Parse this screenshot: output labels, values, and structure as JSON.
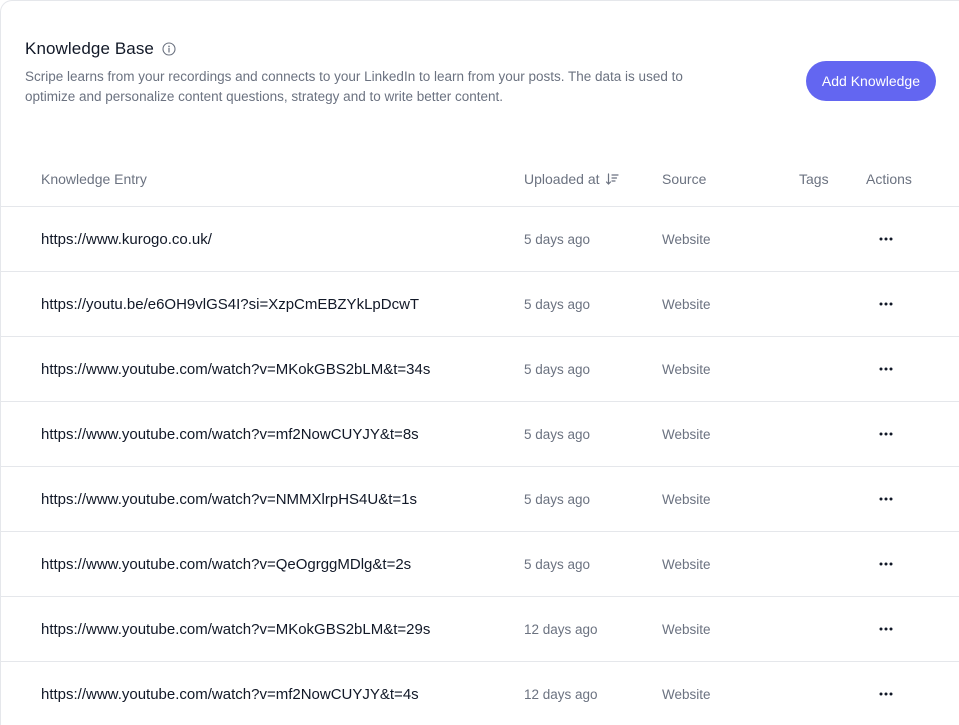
{
  "header": {
    "title": "Knowledge Base",
    "description": "Scripe learns from your recordings and connects to your LinkedIn to learn from your posts. The data is used to optimize and personalize content questions, strategy and to write better content.",
    "add_button_label": "Add Knowledge",
    "info_icon": "info-circle-icon"
  },
  "colors": {
    "accent": "#6366f1",
    "text_primary": "#111827",
    "text_muted": "#6b7280",
    "border": "#e5e7eb"
  },
  "table": {
    "columns": {
      "entry": "Knowledge Entry",
      "uploaded": "Uploaded at",
      "source": "Source",
      "tags": "Tags",
      "actions": "Actions"
    },
    "sort_icon": "sort-descending-icon",
    "actions_icon": "more-horizontal-icon",
    "rows": [
      {
        "entry": "https://www.kurogo.co.uk/",
        "uploaded": "5 days ago",
        "source": "Website",
        "tags": ""
      },
      {
        "entry": "https://youtu.be/e6OH9vlGS4I?si=XzpCmEBZYkLpDcwT",
        "uploaded": "5 days ago",
        "source": "Website",
        "tags": ""
      },
      {
        "entry": "https://www.youtube.com/watch?v=MKokGBS2bLM&t=34s",
        "uploaded": "5 days ago",
        "source": "Website",
        "tags": ""
      },
      {
        "entry": "https://www.youtube.com/watch?v=mf2NowCUYJY&t=8s",
        "uploaded": "5 days ago",
        "source": "Website",
        "tags": ""
      },
      {
        "entry": "https://www.youtube.com/watch?v=NMMXlrpHS4U&t=1s",
        "uploaded": "5 days ago",
        "source": "Website",
        "tags": ""
      },
      {
        "entry": "https://www.youtube.com/watch?v=QeOgrggMDlg&t=2s",
        "uploaded": "5 days ago",
        "source": "Website",
        "tags": ""
      },
      {
        "entry": "https://www.youtube.com/watch?v=MKokGBS2bLM&t=29s",
        "uploaded": "12 days ago",
        "source": "Website",
        "tags": ""
      },
      {
        "entry": "https://www.youtube.com/watch?v=mf2NowCUYJY&t=4s",
        "uploaded": "12 days ago",
        "source": "Website",
        "tags": ""
      }
    ]
  }
}
